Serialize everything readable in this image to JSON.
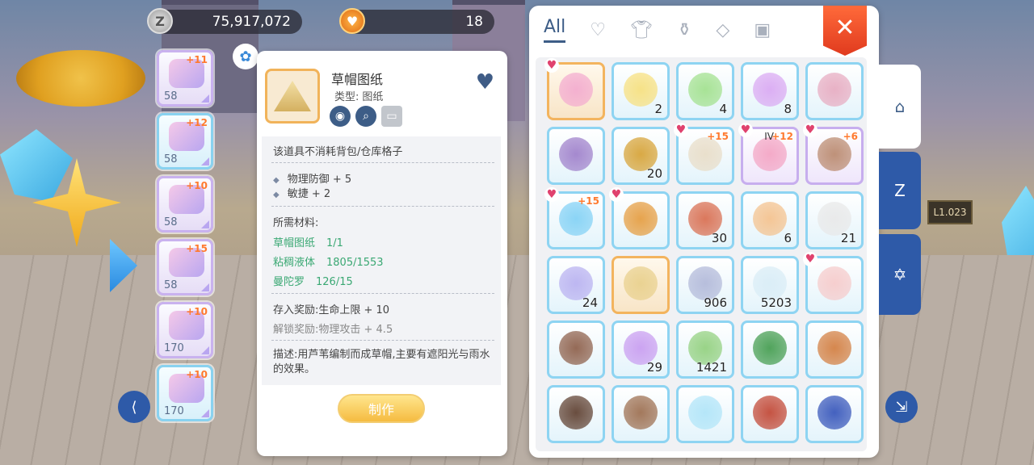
{
  "currency": {
    "zeny": "75,917,072",
    "hearts": "18",
    "zeny_icon": "Z"
  },
  "equipment": [
    {
      "level": "58",
      "plus": "+11",
      "color": "purple"
    },
    {
      "level": "58",
      "plus": "+12",
      "color": "blue"
    },
    {
      "level": "58",
      "plus": "+10",
      "color": "purple"
    },
    {
      "level": "58",
      "plus": "+15",
      "color": "purple"
    },
    {
      "level": "170",
      "plus": "+10",
      "color": "purple"
    },
    {
      "level": "170",
      "plus": "+10",
      "color": "blue"
    }
  ],
  "detail": {
    "name": "草帽图纸",
    "type_label": "类型:",
    "type_value": "图纸",
    "no_slot": "该道具不消耗背包/仓库格子",
    "stats": [
      "物理防御 + 5",
      "敏捷 + 2"
    ],
    "materials_title": "所需材料:",
    "materials": [
      {
        "name": "草帽图纸",
        "count": "1/1"
      },
      {
        "name": "粘稠液体",
        "count": "1805/1553"
      },
      {
        "name": "曼陀罗",
        "count": "126/15"
      }
    ],
    "deposit_reward": "存入奖励:生命上限 + 10",
    "unlock_reward": "解锁奖励:物理攻击 + 4.5",
    "description": "描述:用芦苇编制而成草帽,主要有遮阳光与雨水的效果。",
    "craft_label": "制作"
  },
  "inventory": {
    "tab_all": "All",
    "close_label": "✕",
    "items": [
      {
        "count": "",
        "plus": "",
        "rank": "",
        "fav": true,
        "border": "orange",
        "art": "#f3a9cf"
      },
      {
        "count": "2",
        "plus": "",
        "rank": "",
        "fav": false,
        "border": "blue",
        "art": "#f7df7a"
      },
      {
        "count": "4",
        "plus": "",
        "rank": "",
        "fav": false,
        "border": "blue",
        "art": "#9fe08a"
      },
      {
        "count": "8",
        "plus": "",
        "rank": "",
        "fav": false,
        "border": "blue",
        "art": "#d9a6f2"
      },
      {
        "count": "",
        "plus": "",
        "rank": "",
        "fav": false,
        "border": "blue",
        "art": "#e7a9bf"
      },
      {
        "count": "",
        "plus": "",
        "rank": "",
        "fav": false,
        "border": "blue",
        "art": "#9c7cc9"
      },
      {
        "count": "20",
        "plus": "",
        "rank": "",
        "fav": false,
        "border": "blue",
        "art": "#d6a030"
      },
      {
        "count": "",
        "plus": "+15",
        "rank": "",
        "fav": true,
        "border": "blue",
        "art": "#e8dcc6"
      },
      {
        "count": "",
        "plus": "+12",
        "rank": "IV",
        "fav": true,
        "border": "purple",
        "art": "#f3a2c2"
      },
      {
        "count": "",
        "plus": "+6",
        "rank": "",
        "fav": true,
        "border": "purple",
        "art": "#b8866a"
      },
      {
        "count": "",
        "plus": "+15",
        "rank": "",
        "fav": true,
        "border": "blue",
        "art": "#7fd0f5"
      },
      {
        "count": "",
        "plus": "",
        "rank": "",
        "fav": true,
        "border": "blue",
        "art": "#e59a3a"
      },
      {
        "count": "30",
        "plus": "",
        "rank": "",
        "fav": false,
        "border": "blue",
        "art": "#d8694a"
      },
      {
        "count": "6",
        "plus": "",
        "rank": "",
        "fav": false,
        "border": "blue",
        "art": "#f4c08a"
      },
      {
        "count": "21",
        "plus": "",
        "rank": "",
        "fav": false,
        "border": "blue",
        "art": "#e8e8e8"
      },
      {
        "count": "24",
        "plus": "",
        "rank": "",
        "fav": false,
        "border": "blue",
        "art": "#b7aff0"
      },
      {
        "count": "",
        "plus": "",
        "rank": "",
        "fav": false,
        "border": "orange",
        "art": "#e8cf8a"
      },
      {
        "count": "906",
        "plus": "",
        "rank": "",
        "fav": false,
        "border": "blue",
        "art": "#b0b7d8"
      },
      {
        "count": "5203",
        "plus": "",
        "rank": "",
        "fav": false,
        "border": "blue",
        "art": "#d8ecf6"
      },
      {
        "count": "",
        "plus": "",
        "rank": "",
        "fav": true,
        "border": "blue",
        "art": "#f6c9c9"
      },
      {
        "count": "",
        "plus": "",
        "rank": "",
        "fav": false,
        "border": "blue",
        "art": "#8a5a44"
      },
      {
        "count": "29",
        "plus": "",
        "rank": "",
        "fav": false,
        "border": "blue",
        "art": "#c79af0"
      },
      {
        "count": "1421",
        "plus": "",
        "rank": "",
        "fav": false,
        "border": "blue",
        "art": "#8fcf7a"
      },
      {
        "count": "",
        "plus": "",
        "rank": "",
        "fav": false,
        "border": "blue",
        "art": "#3f9a4a"
      },
      {
        "count": "",
        "plus": "",
        "rank": "",
        "fav": false,
        "border": "blue",
        "art": "#d27a3a"
      },
      {
        "count": "",
        "plus": "",
        "rank": "",
        "fav": false,
        "border": "blue",
        "art": "#5a3a2a"
      },
      {
        "count": "",
        "plus": "",
        "rank": "",
        "fav": false,
        "border": "blue",
        "art": "#9a6a4a"
      },
      {
        "count": "",
        "plus": "",
        "rank": "",
        "fav": false,
        "border": "blue",
        "art": "#aee4f8"
      },
      {
        "count": "",
        "plus": "",
        "rank": "",
        "fav": false,
        "border": "blue",
        "art": "#c0412e"
      },
      {
        "count": "",
        "plus": "",
        "rank": "",
        "fav": false,
        "border": "blue",
        "art": "#3050b8"
      }
    ]
  },
  "sign": {
    "text": "L1.023"
  },
  "colors": {
    "accent": "#3d5d87",
    "close": "#e84a2a",
    "craft": "#f4b020",
    "material_ok": "#3aa873"
  }
}
